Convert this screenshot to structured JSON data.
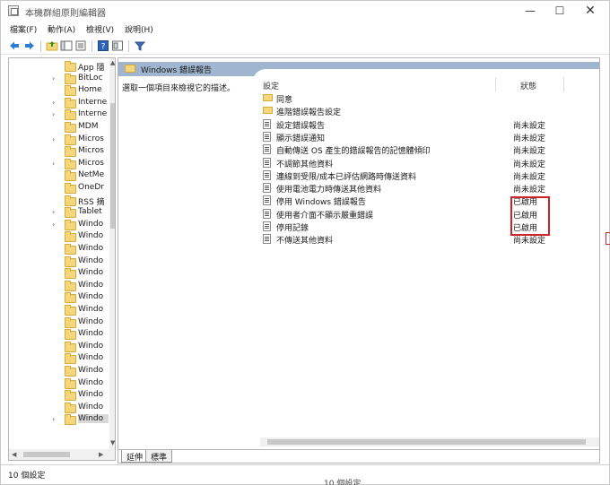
{
  "window": {
    "title": "本機群組原則編輯器",
    "minimize": "—",
    "maximize": "☐",
    "close": "✕"
  },
  "menu": [
    {
      "label": "檔案(F)"
    },
    {
      "label": "動作(A)"
    },
    {
      "label": "檢視(V)"
    },
    {
      "label": "說明(H)"
    }
  ],
  "toolbar": [
    {
      "name": "back-arrow-icon"
    },
    {
      "name": "forward-arrow-icon"
    },
    {
      "name": "up-folder-icon"
    },
    {
      "name": "show-hide-tree-icon"
    },
    {
      "name": "export-list-icon"
    },
    {
      "name": "help-icon"
    },
    {
      "name": "properties-icon"
    },
    {
      "name": "filter-icon"
    }
  ],
  "tree": [
    {
      "label": "App 隱",
      "arrow": ""
    },
    {
      "label": "BitLoc",
      "arrow": "›"
    },
    {
      "label": "Home",
      "arrow": ""
    },
    {
      "label": "Interne",
      "arrow": "›"
    },
    {
      "label": "Interne",
      "arrow": "›"
    },
    {
      "label": "MDM",
      "arrow": ""
    },
    {
      "label": "Micros",
      "arrow": "›"
    },
    {
      "label": "Micros",
      "arrow": ""
    },
    {
      "label": "Micros",
      "arrow": "›"
    },
    {
      "label": "NetMe",
      "arrow": ""
    },
    {
      "label": "OneDr",
      "arrow": ""
    },
    {
      "label": "RSS 摘",
      "arrow": ""
    },
    {
      "label": "Tablet",
      "arrow": "›"
    },
    {
      "label": "Windo",
      "arrow": "›"
    },
    {
      "label": "Windo",
      "arrow": ""
    },
    {
      "label": "Windo",
      "arrow": ""
    },
    {
      "label": "Windo",
      "arrow": ""
    },
    {
      "label": "Windo",
      "arrow": ""
    },
    {
      "label": "Windo",
      "arrow": ""
    },
    {
      "label": "Windo",
      "arrow": ""
    },
    {
      "label": "Windo",
      "arrow": ""
    },
    {
      "label": "Windo",
      "arrow": ""
    },
    {
      "label": "Windo",
      "arrow": ""
    },
    {
      "label": "Windo",
      "arrow": ""
    },
    {
      "label": "Windo",
      "arrow": ""
    },
    {
      "label": "Windo",
      "arrow": ""
    },
    {
      "label": "Windo",
      "arrow": ""
    },
    {
      "label": "Windo",
      "arrow": ""
    },
    {
      "label": "Windo",
      "arrow": ""
    },
    {
      "label": "Windo",
      "arrow": "›",
      "selected": true
    }
  ],
  "panel": {
    "title": "Windows 錯誤報告",
    "description": "選取一個項目來檢視它的描述。",
    "col_setting": "設定",
    "col_state": "狀態"
  },
  "items": [
    {
      "type": "folder",
      "name": "同意",
      "state": ""
    },
    {
      "type": "folder",
      "name": "進階錯誤報告設定",
      "state": ""
    },
    {
      "type": "setting",
      "name": "設定錯誤報告",
      "state": "尚未設定"
    },
    {
      "type": "setting",
      "name": "顯示錯誤通知",
      "state": "尚未設定"
    },
    {
      "type": "setting",
      "name": "自動傳送 OS 產生的錯誤報告的記憶體傾印",
      "state": "尚未設定"
    },
    {
      "type": "setting",
      "name": "不調節其他資料",
      "state": "尚未設定"
    },
    {
      "type": "setting",
      "name": "連線到受限/成本已評估網路時傳送資料",
      "state": "尚未設定"
    },
    {
      "type": "setting",
      "name": "使用電池電力時傳送其他資料",
      "state": "尚未設定"
    },
    {
      "type": "setting",
      "name": "停用 Windows 錯誤報告",
      "state": "已啟用"
    },
    {
      "type": "setting",
      "name": "使用者介面不顯示嚴重錯誤",
      "state": "已啟用"
    },
    {
      "type": "setting",
      "name": "停用記錄",
      "state": "已啟用"
    },
    {
      "type": "setting",
      "name": "不傳送其他資料",
      "state": "尚未設定"
    }
  ],
  "tabs": {
    "extended": "延伸",
    "standard": "標準"
  },
  "status": {
    "text": "10 個設定",
    "ghost": "10 個設定"
  },
  "colors": {
    "header_band": "#9fb5d0",
    "highlight": "#d0222a",
    "folder": "#f5d77b"
  }
}
